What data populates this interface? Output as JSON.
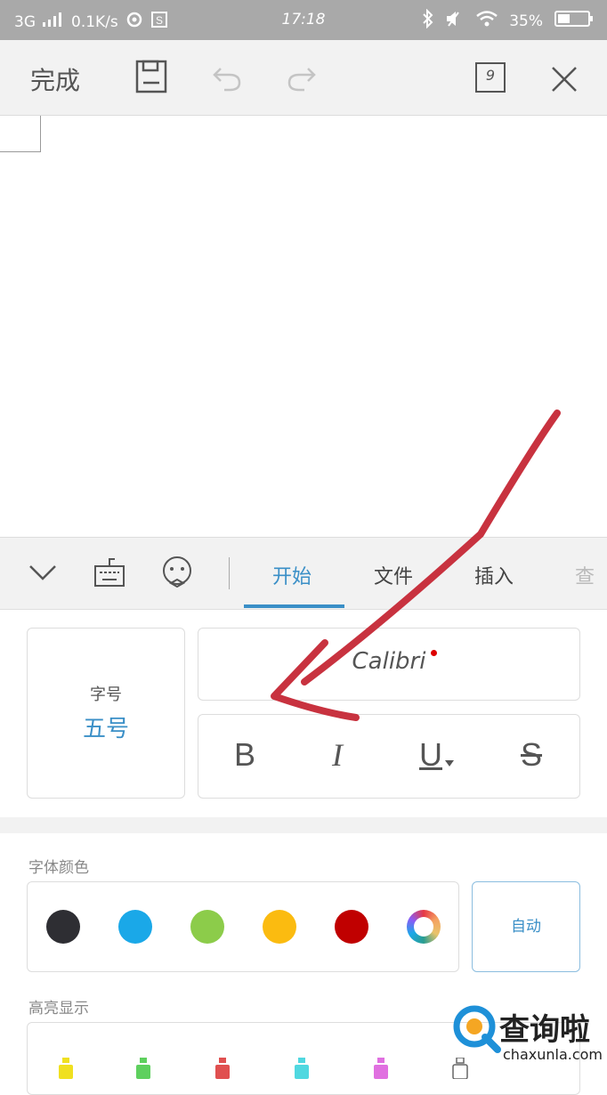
{
  "status_bar": {
    "network": "3G",
    "speed": "0.1K/s",
    "time": "17:18",
    "battery": "35%"
  },
  "toolbar": {
    "done_label": "完成",
    "page_count": "9"
  },
  "tabs": [
    {
      "label": "开始",
      "active": true
    },
    {
      "label": "文件",
      "active": false
    },
    {
      "label": "插入",
      "active": false
    },
    {
      "label": "查",
      "active": false
    }
  ],
  "font_size": {
    "label": "字号",
    "value": "五号"
  },
  "font_family": "Calibri",
  "format_buttons": {
    "bold": "B",
    "italic": "I",
    "underline": "U",
    "strike": "S"
  },
  "font_color": {
    "label": "字体颜色",
    "swatches": [
      "#2e2e33",
      "#1aa8e8",
      "#8ccc4a",
      "#fbbb10",
      "#c00000"
    ],
    "auto_label": "自动"
  },
  "highlight": {
    "label": "高亮显示",
    "colors": [
      "#f0e020",
      "#5ed05e",
      "#e05050",
      "#50d8e0",
      "#e070e0"
    ]
  },
  "watermark": {
    "title": "查询啦",
    "url": "chaxunla.com"
  },
  "colors": {
    "accent": "#3a8fc7",
    "annotation": "#c8323f"
  }
}
